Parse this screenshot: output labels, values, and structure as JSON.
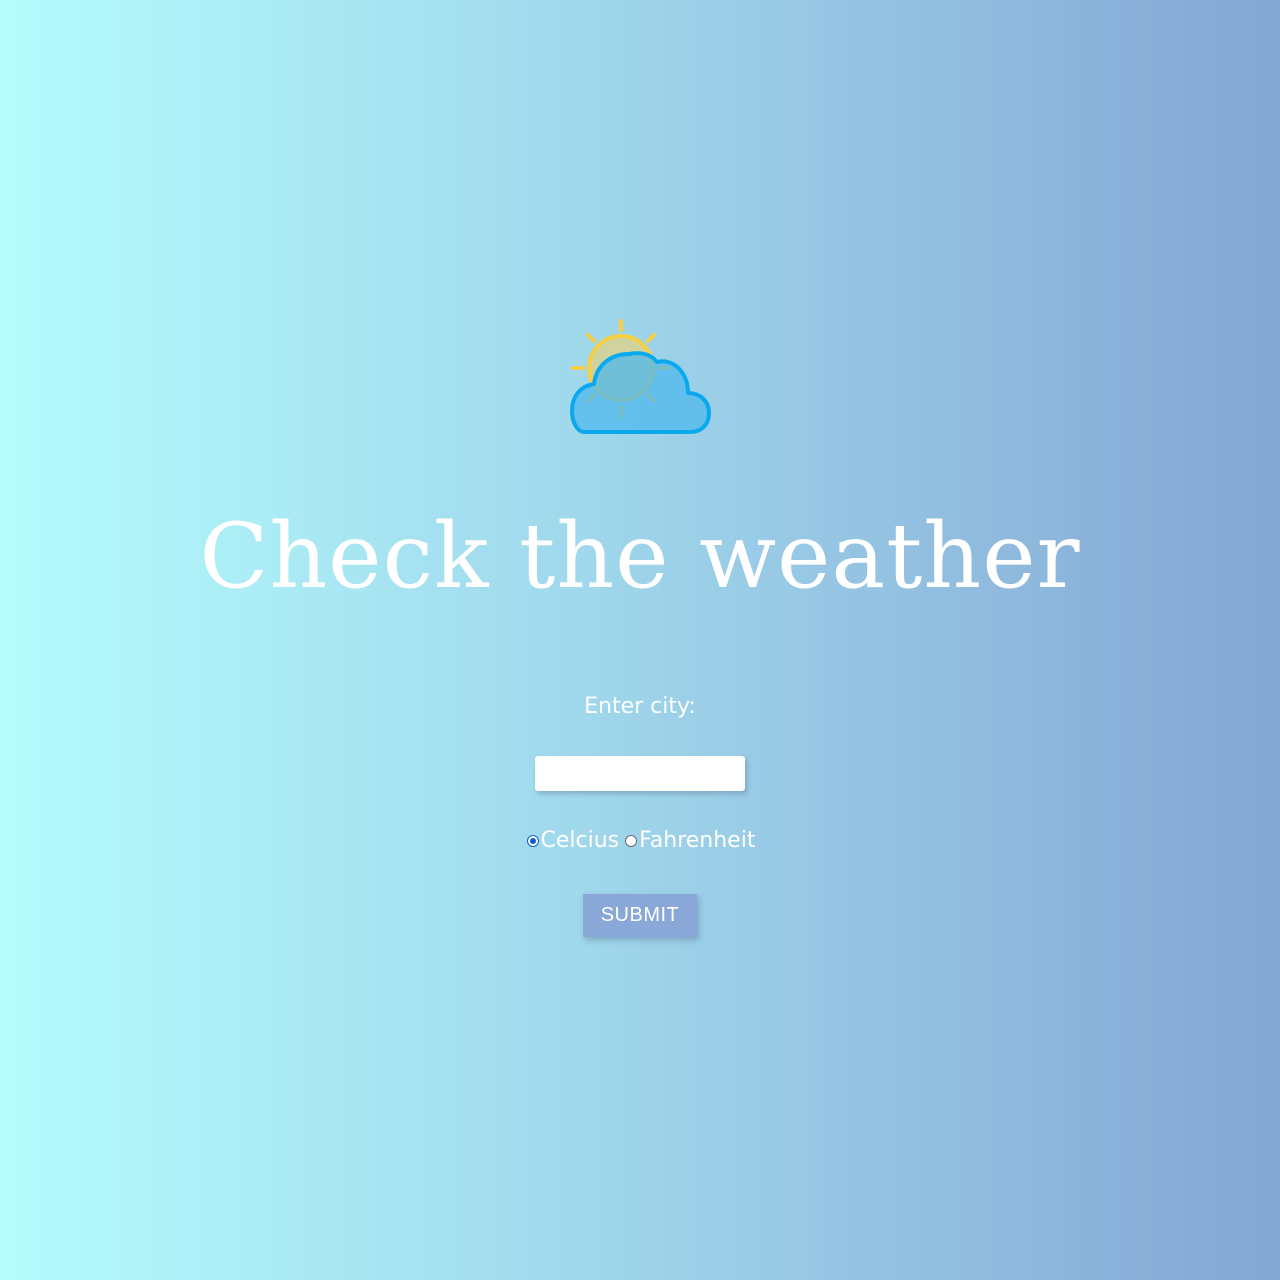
{
  "logo": {
    "icon": "partly-cloudy-icon",
    "sun_color": "#f6cf45",
    "cloud_color": "#0aa9ee"
  },
  "title": "Check the weather",
  "form": {
    "city_label": "Enter city:",
    "city_value": "",
    "city_placeholder": "",
    "units": [
      {
        "label": "Celcius",
        "checked": true
      },
      {
        "label": "Fahrenheit",
        "checked": false
      }
    ],
    "submit_label": "SUBMIT"
  },
  "colors": {
    "gradient_start": "#b4fcfd",
    "gradient_end": "#84a6d4",
    "button": "#89a7d7",
    "radio_accent": "#0a5fd8"
  }
}
